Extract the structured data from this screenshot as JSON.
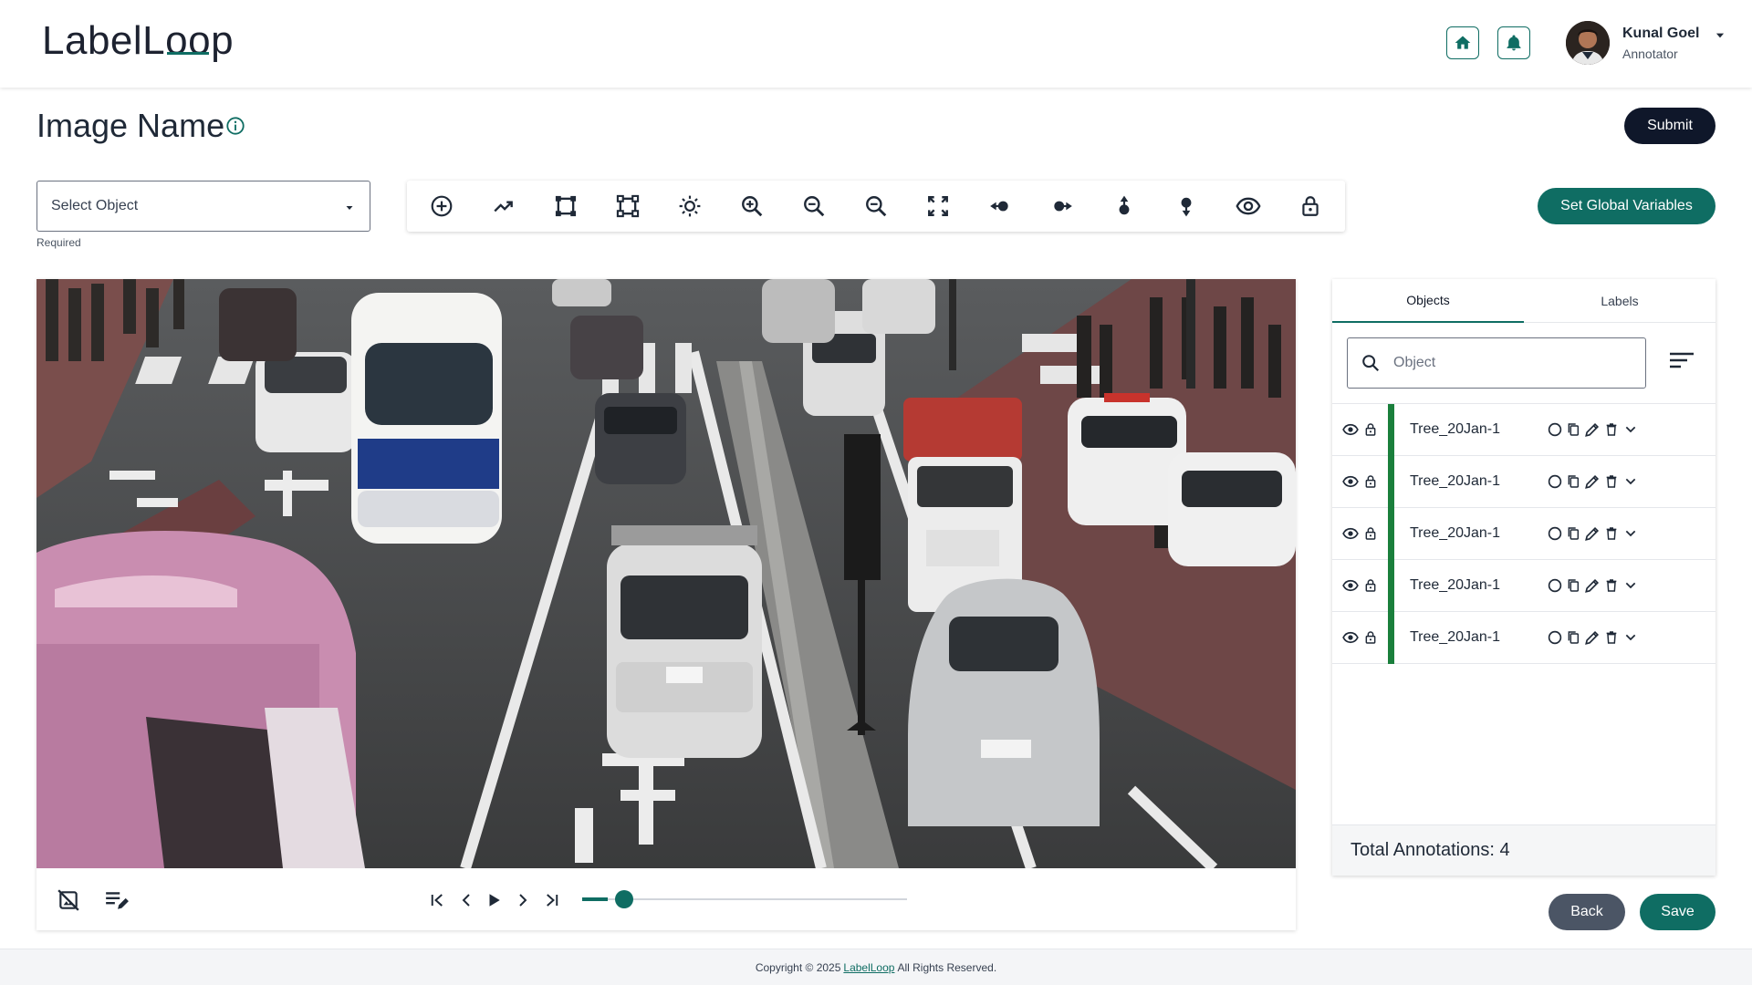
{
  "header": {
    "logo_prefix": "LabelL",
    "logo_loop": "oo",
    "logo_suffix": "p",
    "user": {
      "name": "Kunal Goel",
      "role": "Annotator"
    }
  },
  "page": {
    "title": "Image Name",
    "submit_label": "Submit"
  },
  "object_select": {
    "value": "Select Object",
    "helper": "Required"
  },
  "toolbar": {
    "tools": [
      "add-circle-icon",
      "polyline-icon",
      "bounding-box-icon",
      "polygon-icon",
      "brightness-icon",
      "zoom-in-icon",
      "zoom-out-icon",
      "zoom-reset-icon",
      "fit-screen-icon",
      "move-left-icon",
      "move-right-icon",
      "move-up-icon",
      "move-down-icon",
      "visibility-icon",
      "lock-icon"
    ]
  },
  "global_variables_label": "Set Global Variables",
  "player": {
    "progress": 0.08
  },
  "panel": {
    "tabs": [
      "Objects",
      "Labels"
    ],
    "active_tab": "Objects",
    "search_placeholder": "Object",
    "objects": [
      {
        "name": "Tree_20Jan-1",
        "color": "#1a7f3c"
      },
      {
        "name": "Tree_20Jan-1",
        "color": "#1a7f3c"
      },
      {
        "name": "Tree_20Jan-1",
        "color": "#1a7f3c"
      },
      {
        "name": "Tree_20Jan-1",
        "color": "#1a7f3c"
      },
      {
        "name": "Tree_20Jan-1",
        "color": "#1a7f3c"
      }
    ],
    "total_label": "Total Annotations: 4"
  },
  "actions": {
    "back_label": "Back",
    "save_label": "Save"
  },
  "footer": {
    "prefix": "Copyright © 2025",
    "link": "LabelLoop",
    "suffix": "All Rights Reserved."
  },
  "colors": {
    "accent": "#0f6d63",
    "dark": "#0f172a",
    "stripe": "#1a7f3c"
  }
}
